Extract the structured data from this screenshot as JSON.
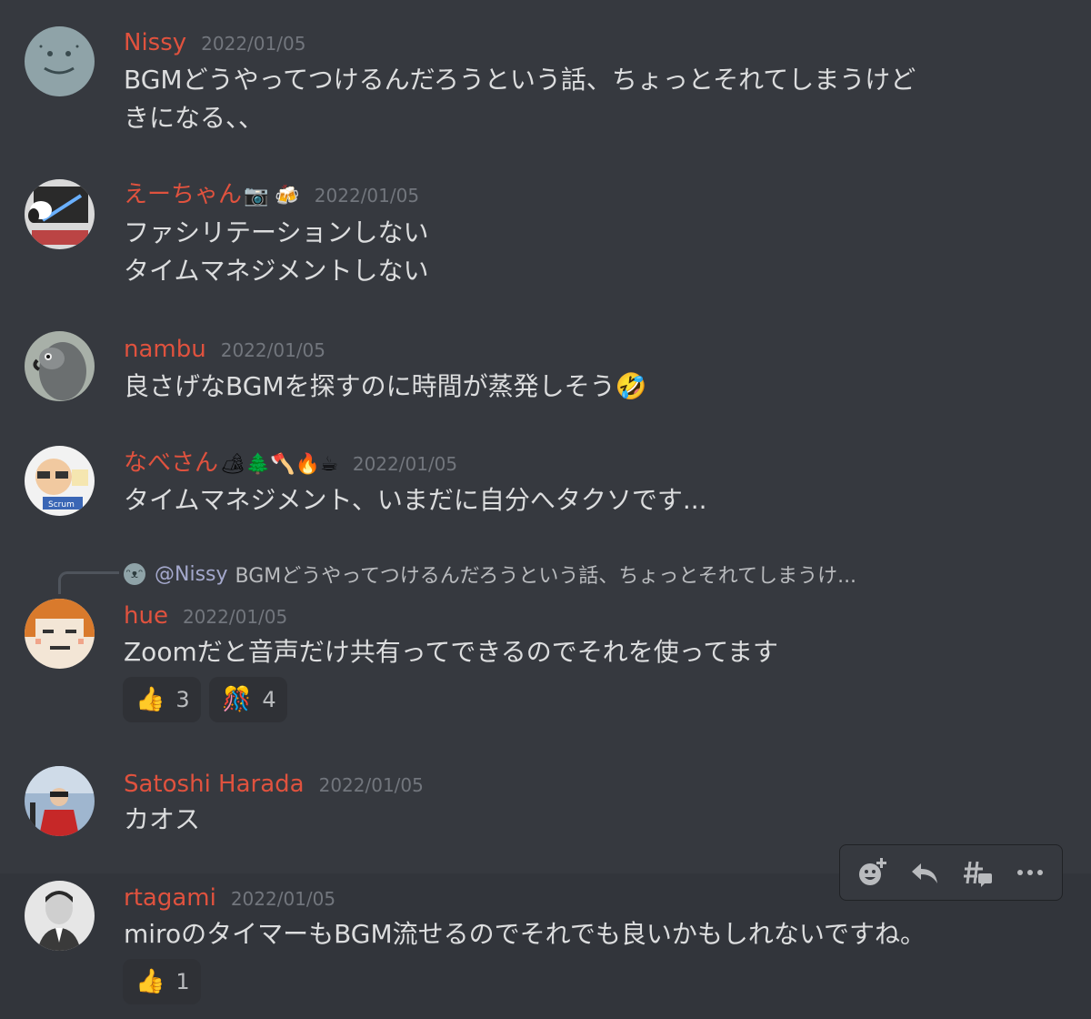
{
  "messages": [
    {
      "username": "Nissy",
      "name_emoji": "",
      "timestamp": "2022/01/05",
      "lines": [
        "BGMどうやってつけるんだろうという話、ちょっとそれてしまうけど",
        "きになる、、"
      ]
    },
    {
      "username": "えーちゃん",
      "name_emoji": "📷 🍻",
      "timestamp": "2022/01/05",
      "lines": [
        "ファシリテーションしない",
        "タイムマネジメントしない"
      ]
    },
    {
      "username": "nambu",
      "name_emoji": "",
      "timestamp": "2022/01/05",
      "lines": [
        "良さげなBGMを探すのに時間が蒸発しそう🤣"
      ]
    },
    {
      "username": "なべさん",
      "name_emoji": "🏕🌲🪓🔥☕",
      "timestamp": "2022/01/05",
      "lines": [
        "タイムマネジメント、いまだに自分へタクソです..."
      ]
    },
    {
      "username": "hue",
      "name_emoji": "",
      "timestamp": "2022/01/05",
      "reply_to": "@Nissy",
      "reply_text": "BGMどうやってつけるんだろうという話、ちょっとそれてしまうけ...",
      "lines": [
        "Zoomだと音声だけ共有ってできるのでそれを使ってます"
      ],
      "reactions": [
        {
          "emoji": "👍",
          "count": "3"
        },
        {
          "emoji": "🎊",
          "count": "4"
        }
      ]
    },
    {
      "username": "Satoshi Harada",
      "name_emoji": "",
      "timestamp": "2022/01/05",
      "lines": [
        "カオス"
      ]
    },
    {
      "username": "rtagami",
      "name_emoji": "",
      "timestamp": "2022/01/05",
      "lines": [
        "miroのタイマーもBGM流せるのでそれでも良いかもしれないですね。"
      ],
      "reactions": [
        {
          "emoji": "👍",
          "count": "1"
        }
      ]
    }
  ],
  "toolbar": {
    "icons": [
      "add-reaction-icon",
      "reply-icon",
      "create-thread-icon",
      "more-icon"
    ]
  },
  "colors": {
    "background": "#36393f",
    "username": "#e0523e",
    "timestamp": "#72767d",
    "text": "#dcddde",
    "reaction_bg": "#2f3136"
  }
}
